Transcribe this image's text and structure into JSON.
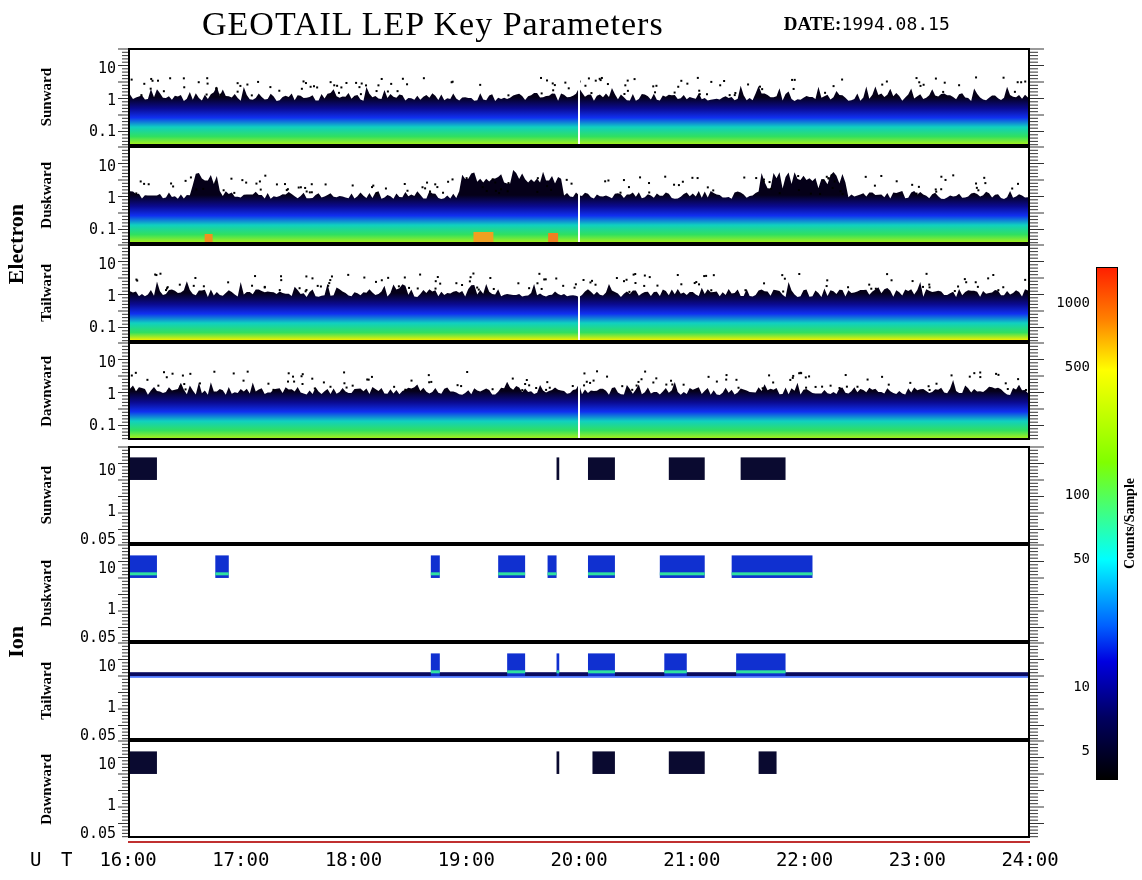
{
  "title": "GEOTAIL LEP Key Parameters",
  "date": {
    "label": "DATE:",
    "value": "1994.08.15"
  },
  "groups": [
    {
      "name": "Electron",
      "kind": "electron",
      "panels": [
        {
          "label": "Sunward",
          "yticks": [
            "10",
            "1",
            "0.1"
          ]
        },
        {
          "label": "Duskward",
          "yticks": [
            "10",
            "1",
            "0.1"
          ]
        },
        {
          "label": "Tailward",
          "yticks": [
            "10",
            "1",
            "0.1"
          ]
        },
        {
          "label": "Dawnward",
          "yticks": [
            "10",
            "1",
            "0.1"
          ]
        }
      ]
    },
    {
      "name": "Ion",
      "kind": "ion",
      "panels": [
        {
          "label": "Sunward",
          "yticks": [
            "10",
            "1",
            "0.05"
          ]
        },
        {
          "label": "Duskward",
          "yticks": [
            "10",
            "1",
            "0.05"
          ]
        },
        {
          "label": "Tailward",
          "yticks": [
            "10",
            "1",
            "0.05"
          ]
        },
        {
          "label": "Dawnward",
          "yticks": [
            "10",
            "1",
            "0.05"
          ]
        }
      ]
    }
  ],
  "xaxis": {
    "label": "U T",
    "ticks": [
      "16:00",
      "17:00",
      "18:00",
      "19:00",
      "20:00",
      "21:00",
      "22:00",
      "23:00",
      "24:00"
    ]
  },
  "colorbar": {
    "label": "Counts/Sample",
    "ticks": [
      "1000",
      "500",
      "100",
      "50",
      "10",
      "5"
    ]
  }
}
